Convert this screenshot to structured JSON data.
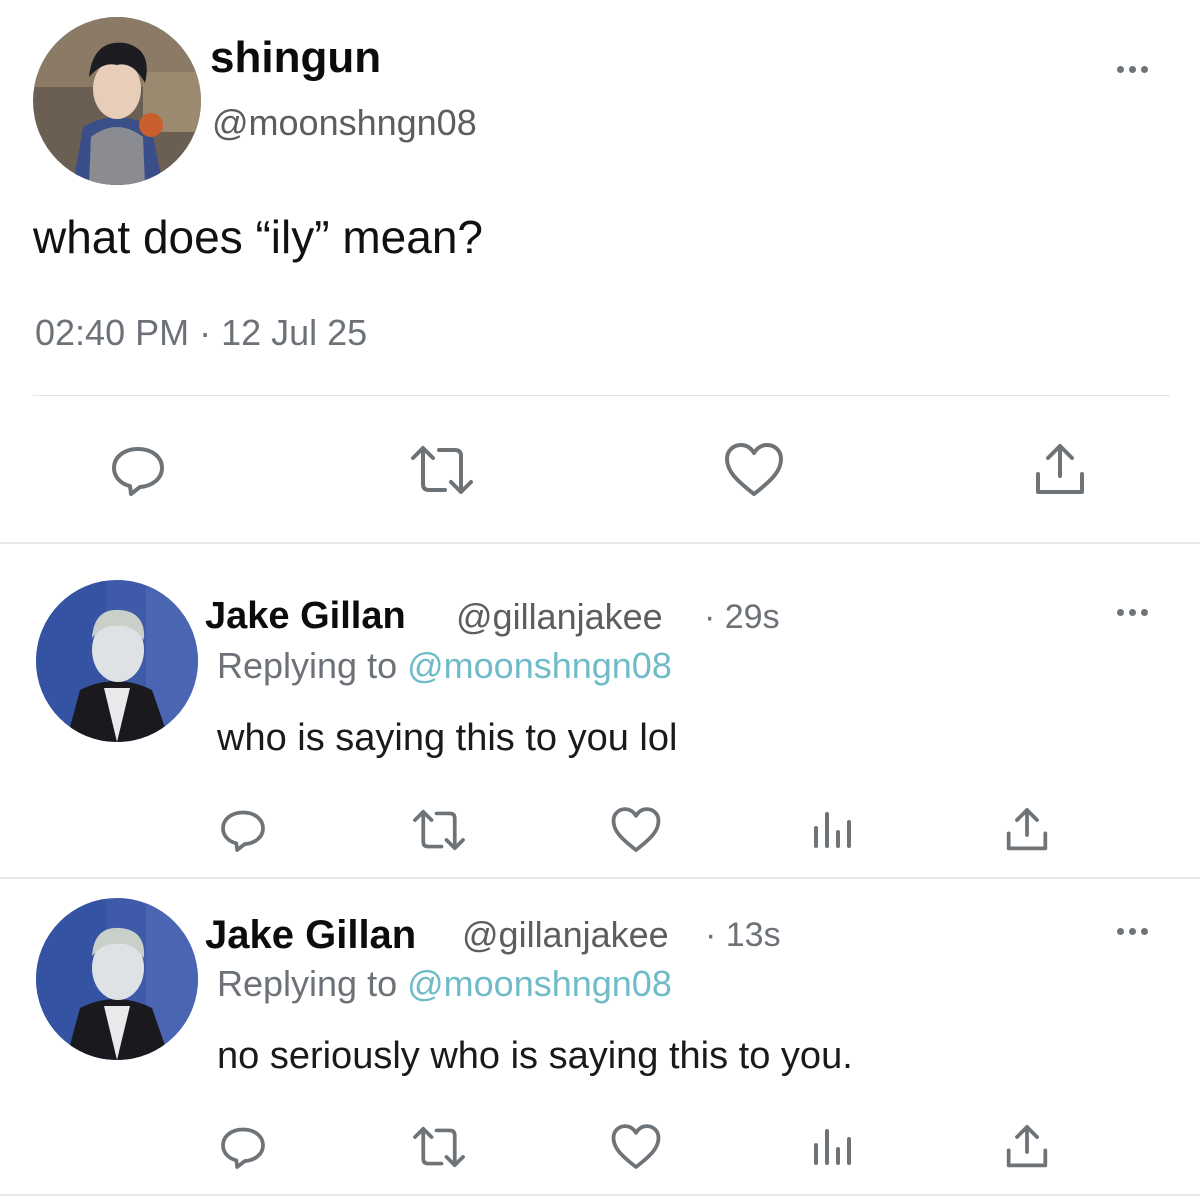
{
  "main_tweet": {
    "display_name": "shingun",
    "handle": "@moonshngn08",
    "text": "what does “ily” mean?",
    "timestamp": "02:40 PM · 12 Jul 25",
    "actions": [
      "reply-icon",
      "retweet-icon",
      "like-icon",
      "share-icon"
    ]
  },
  "replies": [
    {
      "display_name": "Jake Gillan",
      "handle": "@gillanjakee",
      "age": "· 29s",
      "replying_prefix": "Replying to",
      "replying_handle": "@moonshngn08",
      "text": "who is saying this to you lol",
      "actions": [
        "reply-icon",
        "retweet-icon",
        "like-icon",
        "views-icon",
        "share-icon"
      ]
    },
    {
      "display_name": "Jake Gillan",
      "handle": "@gillanjakee",
      "age": "· 13s",
      "replying_prefix": "Replying to",
      "replying_handle": "@moonshngn08",
      "text": "no seriously who is saying this to you.",
      "actions": [
        "reply-icon",
        "retweet-icon",
        "like-icon",
        "views-icon",
        "share-icon"
      ]
    }
  ],
  "colors": {
    "link": "#6fbcc8",
    "icon": "#6e7378",
    "divider": "#e7e7e7"
  }
}
